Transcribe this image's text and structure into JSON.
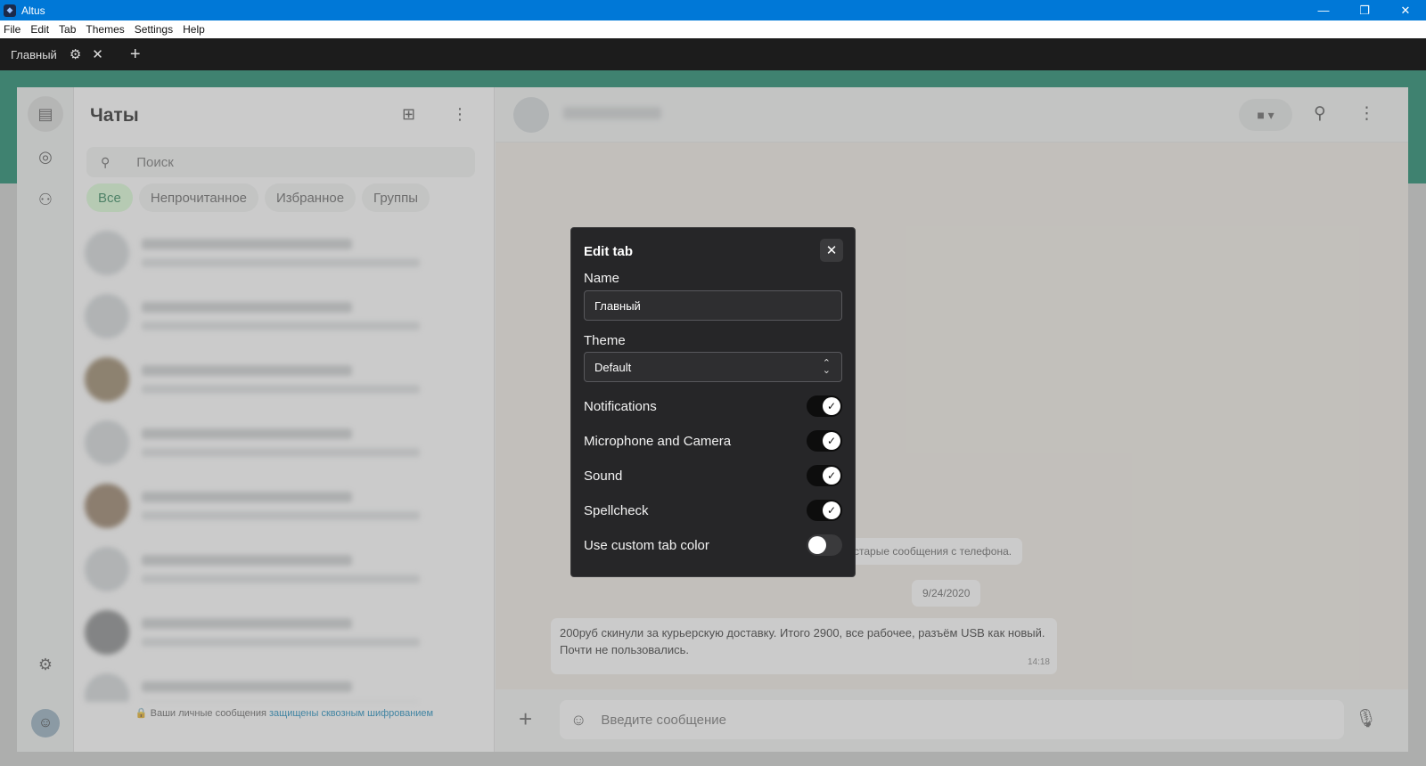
{
  "window": {
    "title": "Altus",
    "minimize": "—",
    "maximize": "❐",
    "close": "✕"
  },
  "menu": [
    "File",
    "Edit",
    "Tab",
    "Themes",
    "Settings",
    "Help"
  ],
  "tabbar": {
    "tab_label": "Главный",
    "settings_icon": "⚙",
    "close_icon": "✕",
    "add_icon": "+"
  },
  "whatsapp": {
    "chatlist": {
      "title": "Чаты",
      "search_placeholder": "Поиск",
      "filters": [
        "Все",
        "Непрочитанное",
        "Избранное",
        "Группы"
      ],
      "encryption_text": "Ваши личные сообщения ",
      "encryption_link": "защищены сквозным шифрованием"
    },
    "chat": {
      "system_message": "чтобы получить свои старые сообщения с телефона.",
      "date": "9/24/2020",
      "message_text": "200руб скинули за курьерскую доставку. Итого 2900, все рабочее, разъём USB как новый. Почти не пользовались.",
      "message_time": "14:18",
      "composer_placeholder": "Введите сообщение"
    }
  },
  "dialog": {
    "title": "Edit tab",
    "close_icon": "✕",
    "name_label": "Name",
    "name_value": "Главный",
    "theme_label": "Theme",
    "theme_value": "Default",
    "toggles": [
      {
        "label": "Notifications",
        "checked": true
      },
      {
        "label": "Microphone and Camera",
        "checked": true
      },
      {
        "label": "Sound",
        "checked": true
      },
      {
        "label": "Spellcheck",
        "checked": true
      },
      {
        "label": "Use custom tab color",
        "checked": false
      }
    ]
  }
}
